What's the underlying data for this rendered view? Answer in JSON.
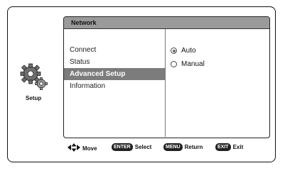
{
  "setup": {
    "label": "Setup"
  },
  "panel": {
    "title": "Network"
  },
  "menu": {
    "items": [
      {
        "label": "Connect",
        "selected": false
      },
      {
        "label": "Status",
        "selected": false
      },
      {
        "label": "Advanced Setup",
        "selected": true
      },
      {
        "label": "Information",
        "selected": false
      }
    ]
  },
  "options": [
    {
      "label": "Auto",
      "selected": true
    },
    {
      "label": "Manual",
      "selected": false
    }
  ],
  "footer": {
    "move_label": "Move",
    "enter_key": "ENTER",
    "enter_label": "Select",
    "menu_key": "MENU",
    "menu_label": "Return",
    "exit_key": "EXIT",
    "exit_label": "Exit"
  },
  "colors": {
    "highlight": "#7c7c7c",
    "title_bar": "#9a9a9a",
    "key_bg": "#222222"
  },
  "icons": {
    "setup": "gears-icon",
    "move": "arrow-keys-icon"
  }
}
